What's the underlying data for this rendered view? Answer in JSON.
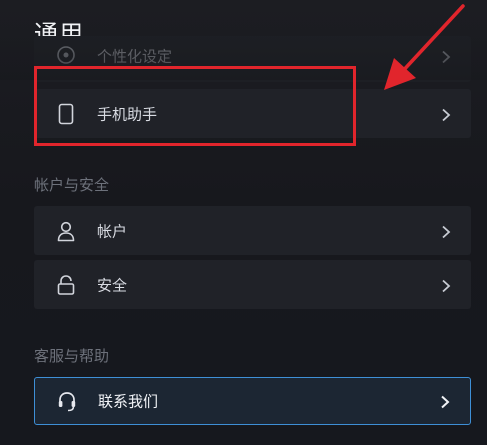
{
  "page": {
    "title": "通用"
  },
  "general": {
    "partial_item": {
      "label": "个性化设定",
      "icon": "palette-icon"
    },
    "phone_assistant": {
      "label": "手机助手",
      "icon": "phone-icon"
    }
  },
  "account_security": {
    "title": "帐户与安全",
    "items": [
      {
        "label": "帐户",
        "icon": "user-icon"
      },
      {
        "label": "安全",
        "icon": "lock-icon"
      }
    ]
  },
  "support": {
    "title": "客服与帮助",
    "items": [
      {
        "label": "联系我们",
        "icon": "headset-icon"
      }
    ]
  },
  "colors": {
    "background": "#17181d",
    "row": "#202228",
    "selected_border": "#3e8fd6",
    "annotation_red": "#e1252c"
  }
}
